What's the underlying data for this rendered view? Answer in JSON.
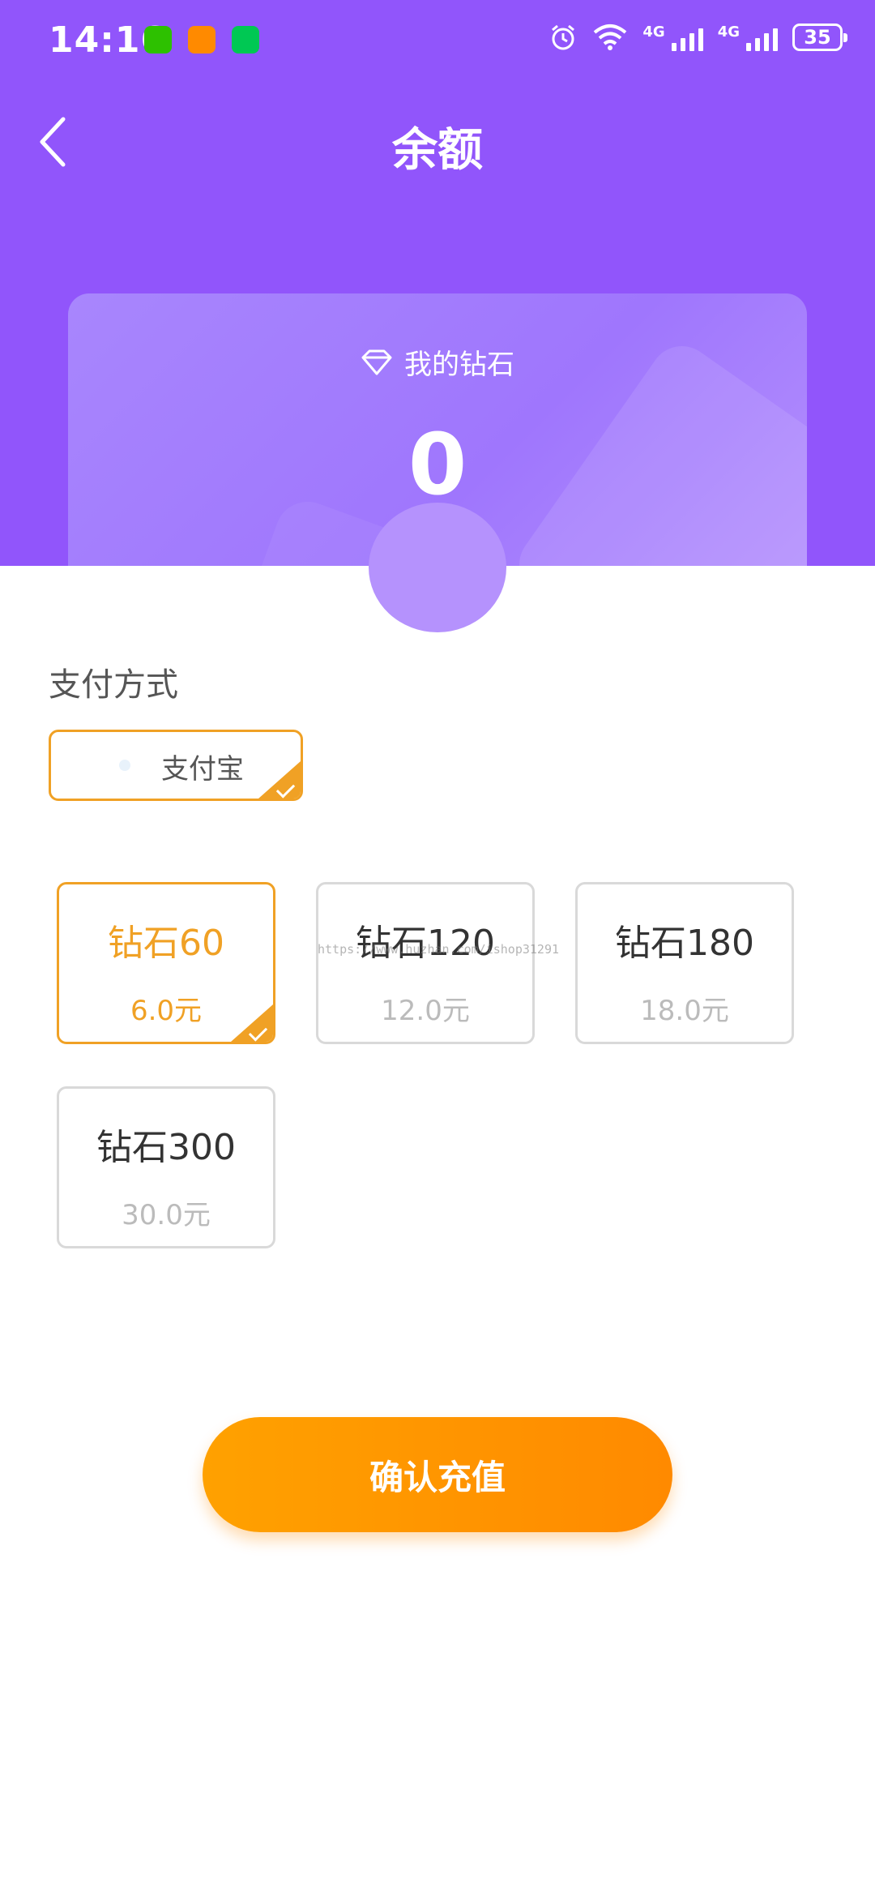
{
  "status_bar": {
    "time": "14:16",
    "network_1": "4G",
    "network_2": "4G",
    "battery": "35",
    "notification_icons": [
      "wechat-icon",
      "video-app-icon",
      "iqiyi-icon"
    ]
  },
  "header": {
    "title": "余额",
    "back_icon": "chevron-left-icon",
    "background_color": "#9155fb"
  },
  "balance_card": {
    "icon": "diamond-icon",
    "label": "我的钻石",
    "value": "0"
  },
  "payment": {
    "section_title": "支付方式",
    "methods": [
      {
        "label": "支付宝",
        "selected": true
      }
    ]
  },
  "packages": [
    {
      "name": "钻石60",
      "price": "6.0元",
      "selected": true
    },
    {
      "name": "钻石120",
      "price": "12.0元",
      "selected": false
    },
    {
      "name": "钻石180",
      "price": "18.0元",
      "selected": false
    },
    {
      "name": "钻石300",
      "price": "30.0元",
      "selected": false
    }
  ],
  "watermark": "https://www.huzhan.com/ishop31291",
  "confirm_button": {
    "label": "确认充值",
    "color": "#ff9500"
  },
  "colors": {
    "accent": "#f0a125",
    "purple": "#9155fb"
  }
}
